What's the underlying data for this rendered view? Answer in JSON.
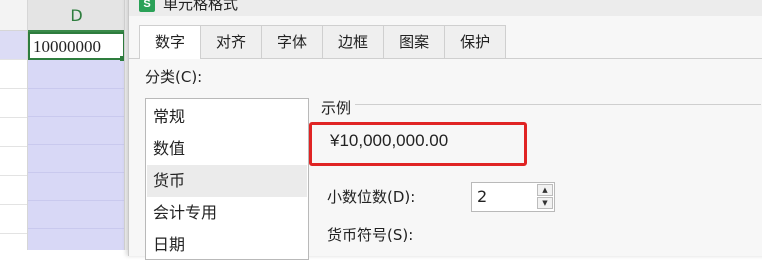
{
  "sheet": {
    "column_header": "D",
    "active_cell_value": "10000000"
  },
  "dialog": {
    "app_icon_letter": "S",
    "title": "单元格格式",
    "tabs": [
      {
        "label": "数字",
        "active": true
      },
      {
        "label": "对齐"
      },
      {
        "label": "字体"
      },
      {
        "label": "边框"
      },
      {
        "label": "图案"
      },
      {
        "label": "保护"
      }
    ],
    "category_label": "分类(C):",
    "categories": [
      {
        "label": "常规"
      },
      {
        "label": "数值"
      },
      {
        "label": "货币",
        "selected": true
      },
      {
        "label": "会计专用"
      },
      {
        "label": "日期"
      }
    ],
    "sample": {
      "group_title": "示例",
      "value": "¥10,000,000.00",
      "highlight_color": "#e02424"
    },
    "decimal_places": {
      "label": "小数位数(D):",
      "value": "2"
    },
    "currency_symbol": {
      "label": "货币符号(S):"
    }
  }
}
